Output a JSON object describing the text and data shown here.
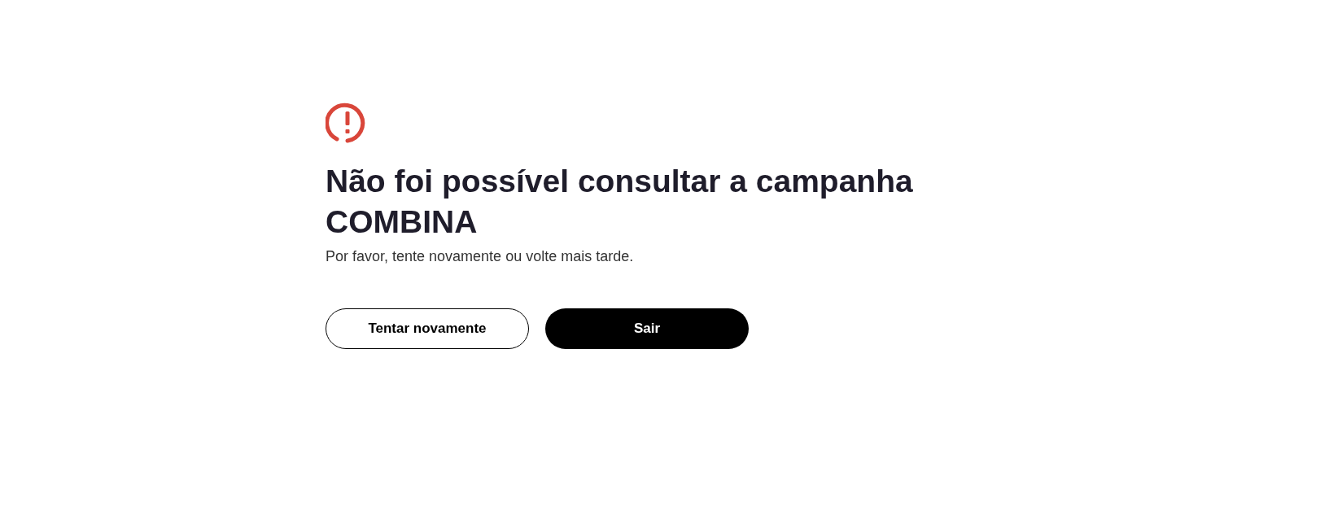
{
  "error": {
    "title": "Não foi possível consultar a campanha  COMBINA",
    "message": "Por favor, tente novamente ou volte mais tarde."
  },
  "buttons": [
    {
      "label": "Tentar novamente",
      "kind": "outline"
    },
    {
      "label": "Sair",
      "kind": "solid"
    }
  ]
}
